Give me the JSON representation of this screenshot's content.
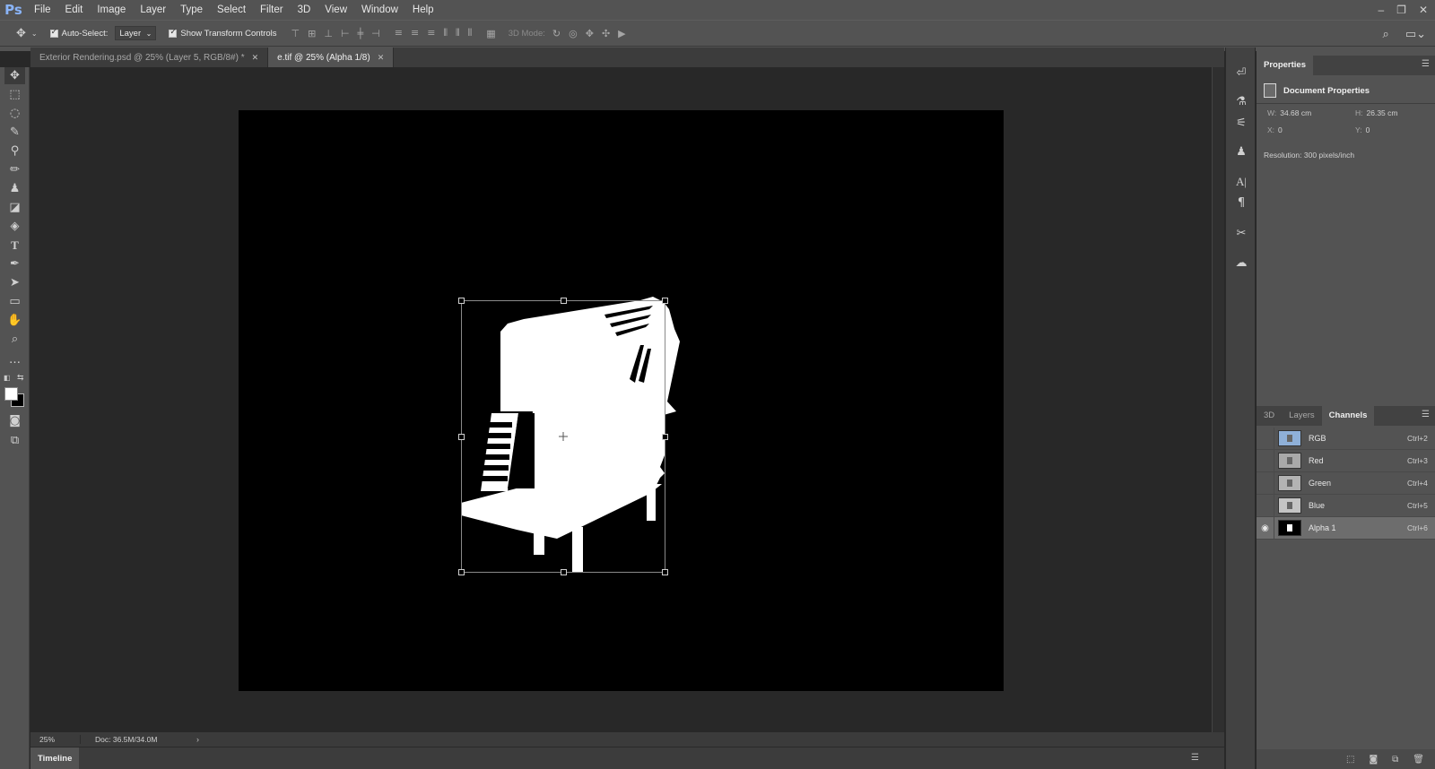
{
  "app": {
    "logo": "Ps"
  },
  "menu": [
    "File",
    "Edit",
    "Image",
    "Layer",
    "Type",
    "Select",
    "Filter",
    "3D",
    "View",
    "Window",
    "Help"
  ],
  "window_controls": {
    "minimize": "–",
    "restore": "❐",
    "close": "✕"
  },
  "options": {
    "auto_select_label": "Auto-Select:",
    "auto_select_checked": true,
    "target_value": "Layer",
    "show_transform_label": "Show Transform Controls",
    "show_transform_checked": true,
    "mode3d_label": "3D Mode:"
  },
  "tabs": [
    {
      "label": "Exterior Rendering.psd @ 25% (Layer 5, RGB/8#) *",
      "active": false
    },
    {
      "label": "e.tif @ 25% (Alpha 1/8)",
      "active": true
    }
  ],
  "status": {
    "zoom": "25%",
    "doc": "Doc: 36.5M/34.0M"
  },
  "timeline": {
    "label": "Timeline"
  },
  "properties": {
    "tab": "Properties",
    "heading": "Document Properties",
    "w_label": "W:",
    "w_value": "34.68 cm",
    "h_label": "H:",
    "h_value": "26.35 cm",
    "x_label": "X:",
    "x_value": "0",
    "y_label": "Y:",
    "y_value": "0",
    "resolution": "Resolution: 300 pixels/inch"
  },
  "lower_tabs": [
    "3D",
    "Layers",
    "Channels"
  ],
  "lower_active": "Channels",
  "channels": [
    {
      "name": "RGB",
      "shortcut": "Ctrl+2",
      "visible": false,
      "selected": false,
      "thumb": "#8fb0d8"
    },
    {
      "name": "Red",
      "shortcut": "Ctrl+3",
      "visible": false,
      "selected": false,
      "thumb": "#a9a9a9"
    },
    {
      "name": "Green",
      "shortcut": "Ctrl+4",
      "visible": false,
      "selected": false,
      "thumb": "#b3b3b3"
    },
    {
      "name": "Blue",
      "shortcut": "Ctrl+5",
      "visible": false,
      "selected": false,
      "thumb": "#c4c4c4"
    },
    {
      "name": "Alpha 1",
      "shortcut": "Ctrl+6",
      "visible": true,
      "selected": true,
      "thumb": "#000000"
    }
  ],
  "colors": {
    "accent": "#8ab4f8",
    "ui_bg": "#535353",
    "canvas_bg": "#282828",
    "document": "#000000",
    "selection_fill": "#ffffff"
  }
}
